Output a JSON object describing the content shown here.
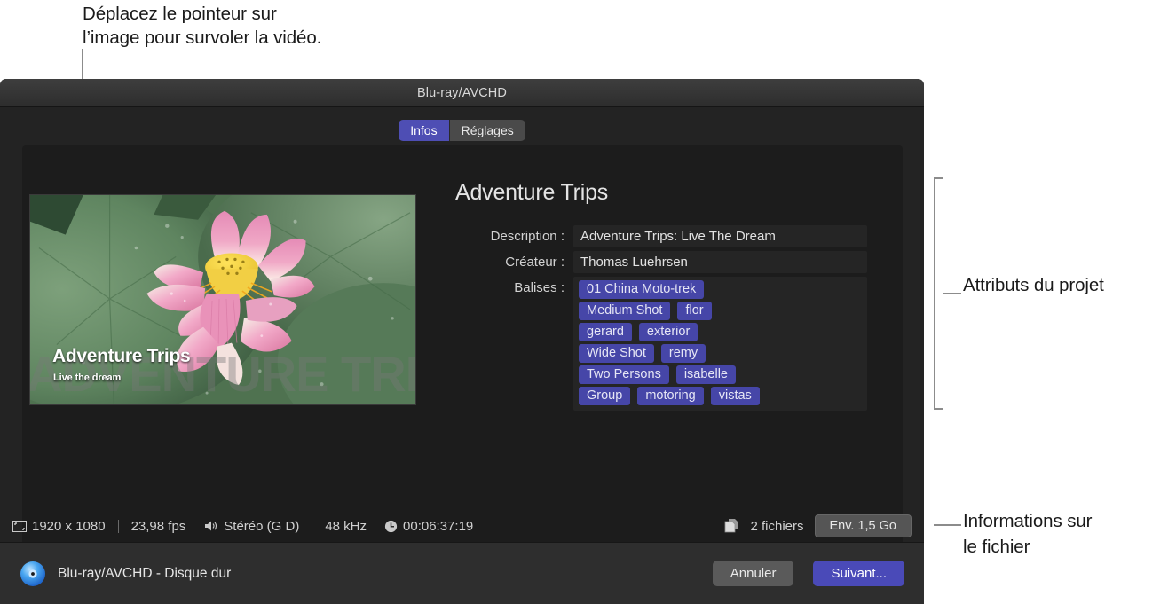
{
  "annotations": {
    "top_callout": "Déplacez le pointeur sur\nl’image pour survoler la vidéo.",
    "right_attributes": "Attributs du projet",
    "right_file_info": "Informations sur\nle fichier"
  },
  "window": {
    "title": "Blu-ray/AVCHD"
  },
  "tabs": [
    {
      "label": "Infos",
      "active": true
    },
    {
      "label": "Réglages",
      "active": false
    }
  ],
  "thumbnail": {
    "overlay_title": "Adventure Trips",
    "overlay_subtitle": "Live the dream",
    "ghost_text": "ADVENTURE TRIPS"
  },
  "details": {
    "project_title": "Adventure Trips",
    "fields": [
      {
        "label": "Description :",
        "value": "Adventure Trips: Live The Dream"
      },
      {
        "label": "Créateur :",
        "value": "Thomas Luehrsen"
      }
    ],
    "tags_label": "Balises :",
    "tag_rows": [
      [
        "01 China Moto-trek"
      ],
      [
        "Medium Shot",
        "flor"
      ],
      [
        "gerard",
        "exterior"
      ],
      [
        "Wide Shot",
        "remy"
      ],
      [
        "Two Persons",
        "isabelle"
      ],
      [
        "Group",
        "motoring",
        "vistas"
      ]
    ]
  },
  "statusbar": {
    "resolution": "1920 x 1080",
    "framerate": "23,98 fps",
    "audio_channels": "Stéréo (G D)",
    "audio_rate": "48 kHz",
    "duration": "00:06:37:19",
    "file_count": "2 fichiers",
    "size_button": "Env. 1,5 Go"
  },
  "bottombar": {
    "disc_label": "Blu-ray/AVCHD - Disque dur",
    "cancel_label": "Annuler",
    "next_label": "Suivant..."
  },
  "colors": {
    "accent": "#4e4eb4",
    "tag_chip": "#4646a8",
    "window_bg": "#1f1f1f",
    "panel_bg": "#1c1c1c",
    "leader_line": "#8c8c8c"
  }
}
